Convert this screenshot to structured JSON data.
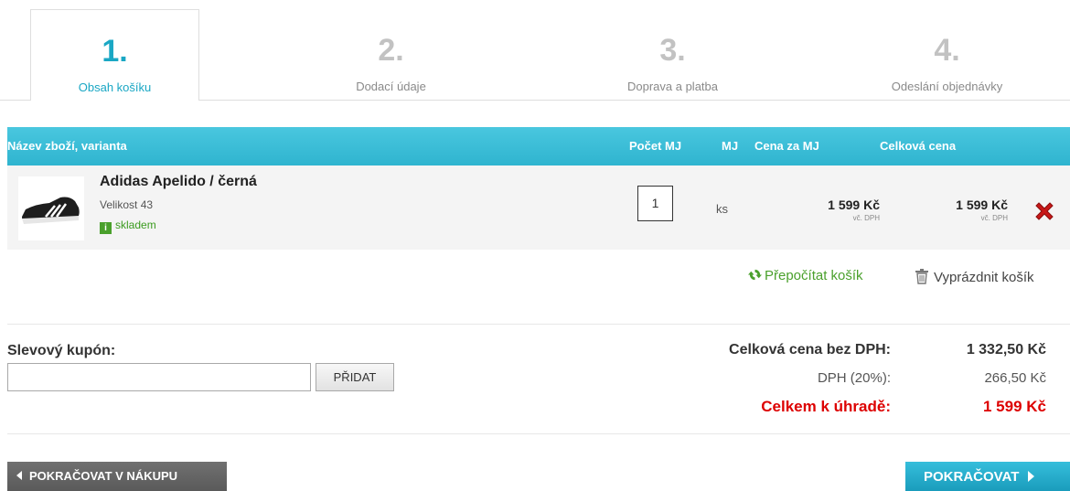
{
  "steps": [
    {
      "num": "1.",
      "label": "Obsah košíku",
      "active": true
    },
    {
      "num": "2.",
      "label": "Dodací údaje",
      "active": false
    },
    {
      "num": "3.",
      "label": "Doprava a platba",
      "active": false
    },
    {
      "num": "4.",
      "label": "Odeslání objednávky",
      "active": false
    }
  ],
  "table": {
    "headers": {
      "name": "Název zboží, varianta",
      "qty": "Počet MJ",
      "unit": "MJ",
      "unit_price": "Cena za MJ",
      "total": "Celková cena"
    },
    "rows": [
      {
        "name": "Adidas Apelido / černá",
        "variant": "Velikost 43",
        "stock_icon": "info-icon",
        "stock_icon_glyph": "i",
        "stock": "skladem",
        "qty": "1",
        "unit": "ks",
        "unit_price": "1 599 Kč",
        "unit_price_note": "vč. DPH",
        "total": "1 599 Kč",
        "total_note": "vč. DPH"
      }
    ]
  },
  "actions": {
    "recalculate": "Přepočítat košík",
    "empty": "Vyprázdnit košík"
  },
  "coupon": {
    "label": "Slevový kupón:",
    "value": "",
    "button": "PŘIDAT"
  },
  "totals": {
    "without_vat_label": "Celková cena bez DPH:",
    "without_vat": "1 332,50 Kč",
    "vat_label": "DPH (20%):",
    "vat": "266,50 Kč",
    "to_pay_label": "Celkem k úhradě:",
    "to_pay": "1 599 Kč"
  },
  "nav": {
    "back": "POKRAČOVAT V NÁKUPU",
    "next": "POKRAČOVAT"
  },
  "colors": {
    "accent": "#1aa7c4",
    "green": "#4aa02c",
    "red": "#dd0000"
  }
}
